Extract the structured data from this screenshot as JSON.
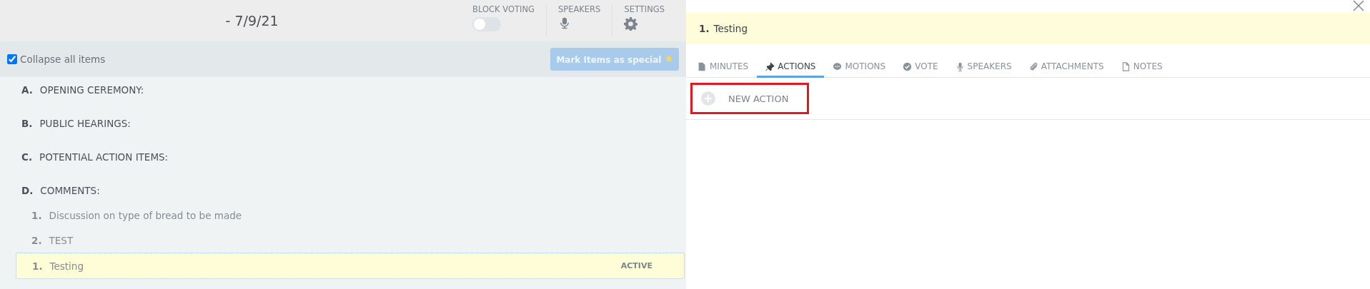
{
  "header": {
    "title": "- 7/9/21",
    "block_voting": {
      "label": "BLOCK VOTING",
      "on": false
    },
    "speakers": {
      "label": "SPEAKERS"
    },
    "settings": {
      "label": "SETTINGS"
    }
  },
  "toolbar": {
    "collapse": {
      "label": "Collapse all items",
      "checked": true
    },
    "mark_button": {
      "label": "Mark Items as special",
      "disabled": true
    }
  },
  "agenda": [
    {
      "number": "A.",
      "title": "OPENING CEREMONY:",
      "selected": false
    },
    {
      "number": "B.",
      "title": "PUBLIC HEARINGS:",
      "selected": false
    },
    {
      "number": "C.",
      "title": "POTENTIAL ACTION ITEMS:",
      "selected": false
    },
    {
      "number": "D.",
      "title": "COMMENTS:",
      "selected": false,
      "children": [
        {
          "number": "1.",
          "title": "Discussion on type of bread to be made",
          "selected": false
        },
        {
          "number": "2.",
          "title": "TEST",
          "selected": false
        },
        {
          "number": "1.",
          "title": "Testing",
          "selected": true,
          "status": "ACTIVE"
        }
      ]
    }
  ],
  "detail": {
    "number": "1.",
    "title": "Testing",
    "tabs": [
      {
        "label": "MINUTES",
        "selected": false
      },
      {
        "label": "ACTIONS",
        "selected": true
      },
      {
        "label": "MOTIONS",
        "selected": false
      },
      {
        "label": "VOTE",
        "selected": false
      },
      {
        "label": "SPEAKERS",
        "selected": false
      },
      {
        "label": "ATTACHMENTS",
        "selected": false
      },
      {
        "label": "NOTES",
        "selected": false
      }
    ],
    "new_action": {
      "label": "NEW ACTION",
      "highlighted": true
    }
  }
}
